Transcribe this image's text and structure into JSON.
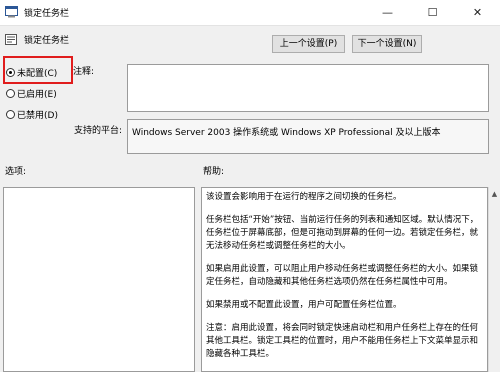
{
  "window": {
    "title": "锁定任务栏",
    "minimize": "—",
    "maximize": "☐",
    "close": "✕"
  },
  "header": {
    "title": "锁定任务栏",
    "prev_button": "上一个设置(P)",
    "next_button": "下一个设置(N)"
  },
  "state": {
    "options": [
      {
        "label": "未配置(C)",
        "selected": true
      },
      {
        "label": "已启用(E)",
        "selected": false
      },
      {
        "label": "已禁用(D)",
        "selected": false
      }
    ]
  },
  "labels": {
    "comment": "注释:",
    "supported_on": "支持的平台:",
    "options": "选项:",
    "help": "帮助:"
  },
  "supported_on_value": "Windows Server 2003 操作系统或 Windows XP Professional 及以上版本",
  "help_paragraphs": [
    "该设置会影响用于在运行的程序之间切换的任务栏。",
    "任务栏包括“开始”按钮、当前运行任务的列表和通知区域。默认情况下，任务栏位于屏幕底部，但是可拖动到屏幕的任何一边。若锁定任务栏，就无法移动任务栏或调整任务栏的大小。",
    "如果启用此设置，可以阻止用户移动任务栏或调整任务栏的大小。如果锁定任务栏，自动隐藏和其他任务栏选项仍然在任务栏属性中可用。",
    "如果禁用或不配置此设置，用户可配置任务栏位置。",
    "注意：启用此设置，将会同时锁定快速启动栏和用户任务栏上存在的任何其他工具栏。锁定工具栏的位置时，用户不能用任务栏上下文菜单显示和隐藏各种工具栏。"
  ]
}
